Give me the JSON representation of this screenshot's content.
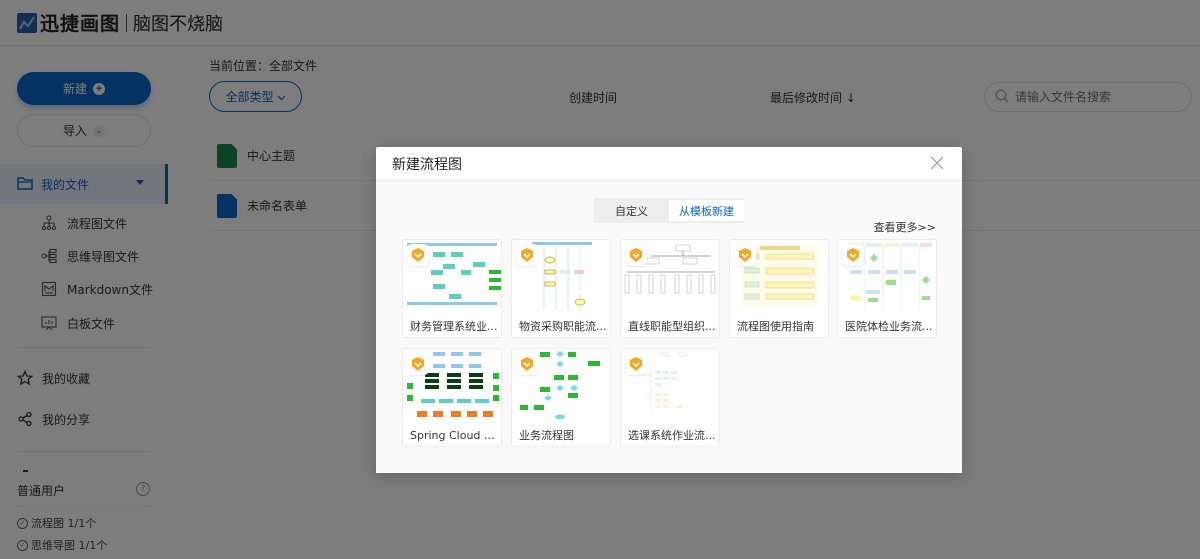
{
  "header": {
    "brand": "迅捷画图",
    "slogan": "脑图不烧脑"
  },
  "sidebar": {
    "new_label": "新建",
    "import_label": "导入",
    "my_files_label": "我的文件",
    "sub_items": [
      {
        "label": "流程图文件",
        "icon": "flowchart-icon"
      },
      {
        "label": "思维导图文件",
        "icon": "mindmap-icon"
      },
      {
        "label": "Markdown文件",
        "icon": "markdown-icon"
      },
      {
        "label": "白板文件",
        "icon": "whiteboard-icon"
      }
    ],
    "favorites_label": "我的收藏",
    "shares_label": "我的分享",
    "user_type": "普通用户",
    "quotas": [
      {
        "label": "流程图 1/1个"
      },
      {
        "label": "思维导图 1/1个"
      }
    ]
  },
  "main": {
    "breadcrumb": "当前位置：全部文件",
    "filter_label": "全部类型",
    "col_created": "创建时间",
    "col_modified": "最后修改时间 ↓",
    "search_placeholder": "请输入文件名搜索",
    "files": [
      {
        "name": "中心主题",
        "type": "mindmap",
        "color": "#1f8a4c"
      },
      {
        "name": "未命名表单",
        "type": "flowchart",
        "color": "#0a66c9"
      }
    ]
  },
  "modal": {
    "title": "新建流程图",
    "tabs": [
      {
        "label": "自定义",
        "active": false
      },
      {
        "label": "从模板新建",
        "active": true
      }
    ],
    "more_label": "查看更多>>",
    "templates": [
      {
        "name": "财务管理系统业..."
      },
      {
        "name": "物资采购职能流..."
      },
      {
        "name": "直线职能型组织..."
      },
      {
        "name": "流程图使用指南"
      },
      {
        "name": "医院体检业务流..."
      },
      {
        "name": "Spring Cloud 微..."
      },
      {
        "name": "业务流程图"
      },
      {
        "name": "选课系统作业流..."
      }
    ]
  },
  "colors": {
    "accent": "#0a66c9",
    "premium_badge": "#f5a623",
    "overlay": "rgba(0,0,0,0.51)"
  }
}
